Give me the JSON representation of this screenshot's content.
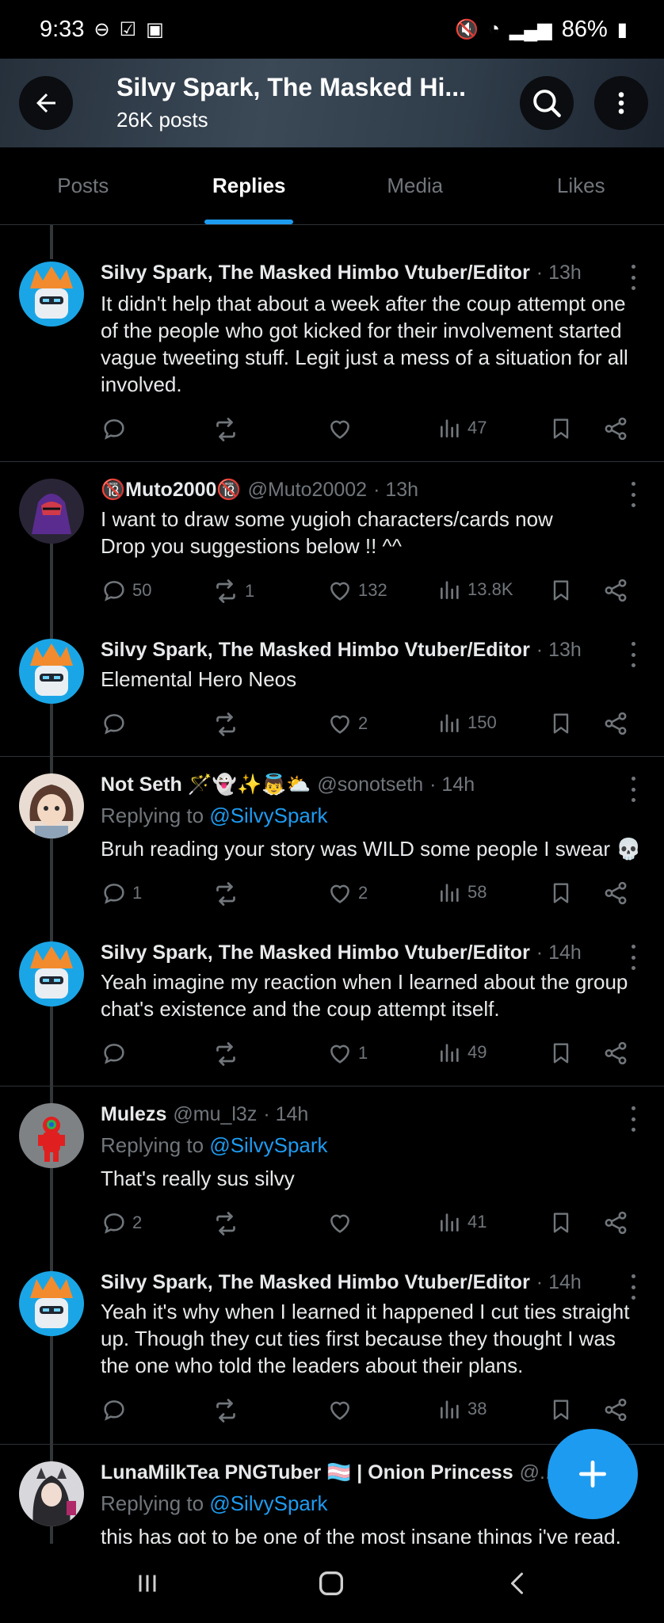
{
  "status_bar": {
    "time": "9:33",
    "battery": "86%"
  },
  "header": {
    "title": "Silvy Spark, The Masked Hi...",
    "post_count": "26K posts"
  },
  "tabs": [
    {
      "label": "Posts",
      "active": false
    },
    {
      "label": "Replies",
      "active": true
    },
    {
      "label": "Media",
      "active": false
    },
    {
      "label": "Likes",
      "active": false
    }
  ],
  "tweets": [
    {
      "name": "Silvy Spark, The Masked Himbo Vtuber/Editor",
      "handle": "",
      "time": "· 13h",
      "replying_label": "",
      "replying_handle": "",
      "text": "It didn't help that about a week after the coup attempt one of the people who got kicked for their involvement started vague tweeting stuff. Legit just a mess of a situation for all involved.",
      "replies": "",
      "reposts": "",
      "likes": "",
      "views": "47"
    },
    {
      "name": "🔞Muto2000🔞",
      "handle": "@Muto20002",
      "time": "· 13h",
      "replying_label": "",
      "replying_handle": "",
      "text": "I want to draw some yugioh characters/cards now\nDrop you suggestions below !! ^^",
      "replies": "50",
      "reposts": "1",
      "likes": "132",
      "views": "13.8K"
    },
    {
      "name": "Silvy Spark, The Masked Himbo Vtuber/Editor",
      "handle": "",
      "time": "· 13h",
      "replying_label": "",
      "replying_handle": "",
      "text": "Elemental Hero Neos",
      "replies": "",
      "reposts": "",
      "likes": "2",
      "views": "150"
    },
    {
      "name": "Not Seth 🪄👻✨👼⛅",
      "handle": "@sonotseth",
      "time": "· 14h",
      "replying_label": "Replying to",
      "replying_handle": "@SilvySpark",
      "text": "Bruh reading your story was WILD some people I swear 💀",
      "replies": "1",
      "reposts": "",
      "likes": "2",
      "views": "58"
    },
    {
      "name": "Silvy Spark, The Masked Himbo Vtuber/Editor",
      "handle": "",
      "time": "· 14h",
      "replying_label": "",
      "replying_handle": "",
      "text": "Yeah imagine my reaction when I learned about the group chat's existence and the coup attempt itself.",
      "replies": "",
      "reposts": "",
      "likes": "1",
      "views": "49"
    },
    {
      "name": "Mulezs",
      "handle": "@mu_l3z",
      "time": "· 14h",
      "replying_label": "Replying to",
      "replying_handle": "@SilvySpark",
      "text": "That's really sus silvy",
      "replies": "2",
      "reposts": "",
      "likes": "",
      "views": "41"
    },
    {
      "name": "Silvy Spark, The Masked Himbo Vtuber/Editor",
      "handle": "",
      "time": "· 14h",
      "replying_label": "",
      "replying_handle": "",
      "text": "Yeah it's why when I learned it happened I cut ties straight up. Though they cut ties first because they thought I was the one who told the leaders about their plans.",
      "replies": "",
      "reposts": "",
      "likes": "",
      "views": "38"
    },
    {
      "name": "LunaMilkTea PNGTuber 🏳️‍⚧️ | Onion Princess",
      "handle": "@...",
      "time": "",
      "replying_label": "Replying to",
      "replying_handle": "@SilvySpark",
      "text": "this has got to be one of the most insane things i've read.",
      "replies": "",
      "reposts": "",
      "likes": "",
      "views": ""
    }
  ],
  "icons": {
    "back": "back-arrow-icon",
    "search": "search-icon",
    "more": "more-vertical-icon",
    "reply": "reply-bubble-icon",
    "repost": "repost-icon",
    "like": "heart-icon",
    "views": "views-chart-icon",
    "bookmark": "bookmark-icon",
    "share": "share-icon",
    "compose": "plus-icon"
  },
  "colors": {
    "accent": "#1d9bf0",
    "muted": "#71767b",
    "text": "#e7e9ea",
    "bg": "#000000"
  }
}
